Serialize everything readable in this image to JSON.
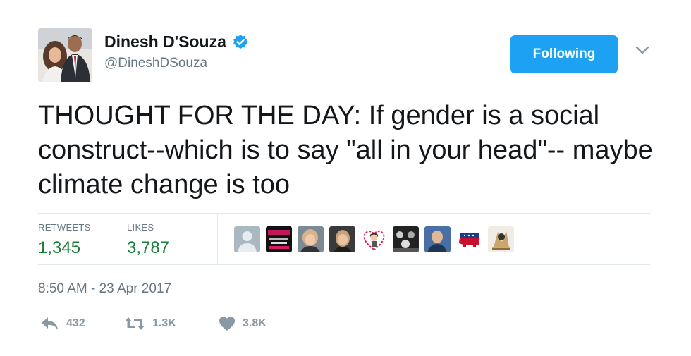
{
  "tweet": {
    "author": {
      "display_name": "Dinesh D'Souza",
      "handle": "@DineshDSouza",
      "verified_icon": "verified-badge-icon"
    },
    "follow_button_label": "Following",
    "menu_icon": "chevron-down-icon",
    "text": "THOUGHT FOR THE DAY: If gender is a social construct--which is to say \"all in your head\"-- maybe climate change is too",
    "stats": {
      "retweets_label": "RETWEETS",
      "retweets_value": "1,345",
      "likes_label": "LIKES",
      "likes_value": "3,787",
      "liker_avatars": [
        "default-avatar",
        "proud-sign",
        "woman-photo",
        "woman-photo-2",
        "heart-avatar",
        "group-photo",
        "man-photo",
        "elephant-logo",
        "cartoon-avatar"
      ]
    },
    "timestamp": "8:50 AM - 23 Apr 2017",
    "actions": {
      "reply_count": "432",
      "retweet_count": "1.3K",
      "like_count": "3.8K"
    },
    "colors": {
      "accent": "#1da1f2",
      "stat_value": "#1b7f3b",
      "muted": "#657786"
    }
  }
}
